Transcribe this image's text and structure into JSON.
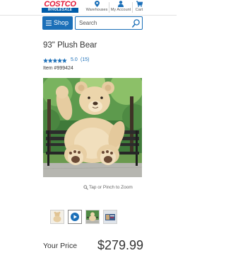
{
  "header": {
    "logo_main": "COSTCO",
    "logo_sub": "WHOLESALE",
    "nav": [
      {
        "label": "Warehouses",
        "icon": "location-pin-icon"
      },
      {
        "label": "My Account",
        "icon": "person-icon"
      },
      {
        "label": "Cart",
        "icon": "shopping-cart-icon"
      }
    ]
  },
  "search": {
    "shop_label": "Shop",
    "placeholder": "Search"
  },
  "product": {
    "title": "93\" Plush Bear",
    "rating_stars": 5,
    "rating_value": "5.0",
    "rating_count": "(15)",
    "item_number": "Item #999424",
    "zoom_hint": "Tap or Pinch to Zoom",
    "thumbnails": [
      {
        "icon": "bear-thumbnail-icon"
      },
      {
        "icon": "play-video-icon"
      },
      {
        "icon": "bear-bench-thumbnail-icon"
      },
      {
        "icon": "bear-box-thumbnail-icon"
      }
    ],
    "price_label": "Your Price",
    "price": "$279.99"
  },
  "colors": {
    "brand_red": "#e31837",
    "brand_blue": "#005daa",
    "button_blue": "#1b6fb8",
    "star_blue": "#1b6fb8"
  }
}
